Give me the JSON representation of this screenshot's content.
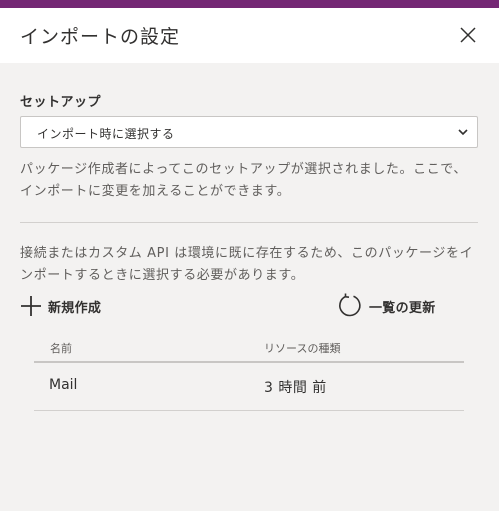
{
  "dialog": {
    "title": "インポートの設定",
    "close_icon": "close-icon"
  },
  "setup": {
    "heading": "セットアップ",
    "selected_option": "インポート時に選択する",
    "description": "パッケージ作成者によってこのセットアップが選択されました。ここで、インポートに変更を加えることができます。"
  },
  "connections": {
    "description": "接続またはカスタム API は環境に既に存在するため、このパッケージをインポートするときに選択する必要があります。",
    "new_label": "新規作成",
    "refresh_label": "一覧の更新",
    "columns": [
      "名前",
      "リソースの種類"
    ],
    "rows": [
      {
        "name": "Mail",
        "type": "3 時間 前"
      }
    ]
  },
  "colors": {
    "accent": "#742774",
    "panel_bg": "#f3f2f1",
    "header_bg": "#ffffff"
  }
}
